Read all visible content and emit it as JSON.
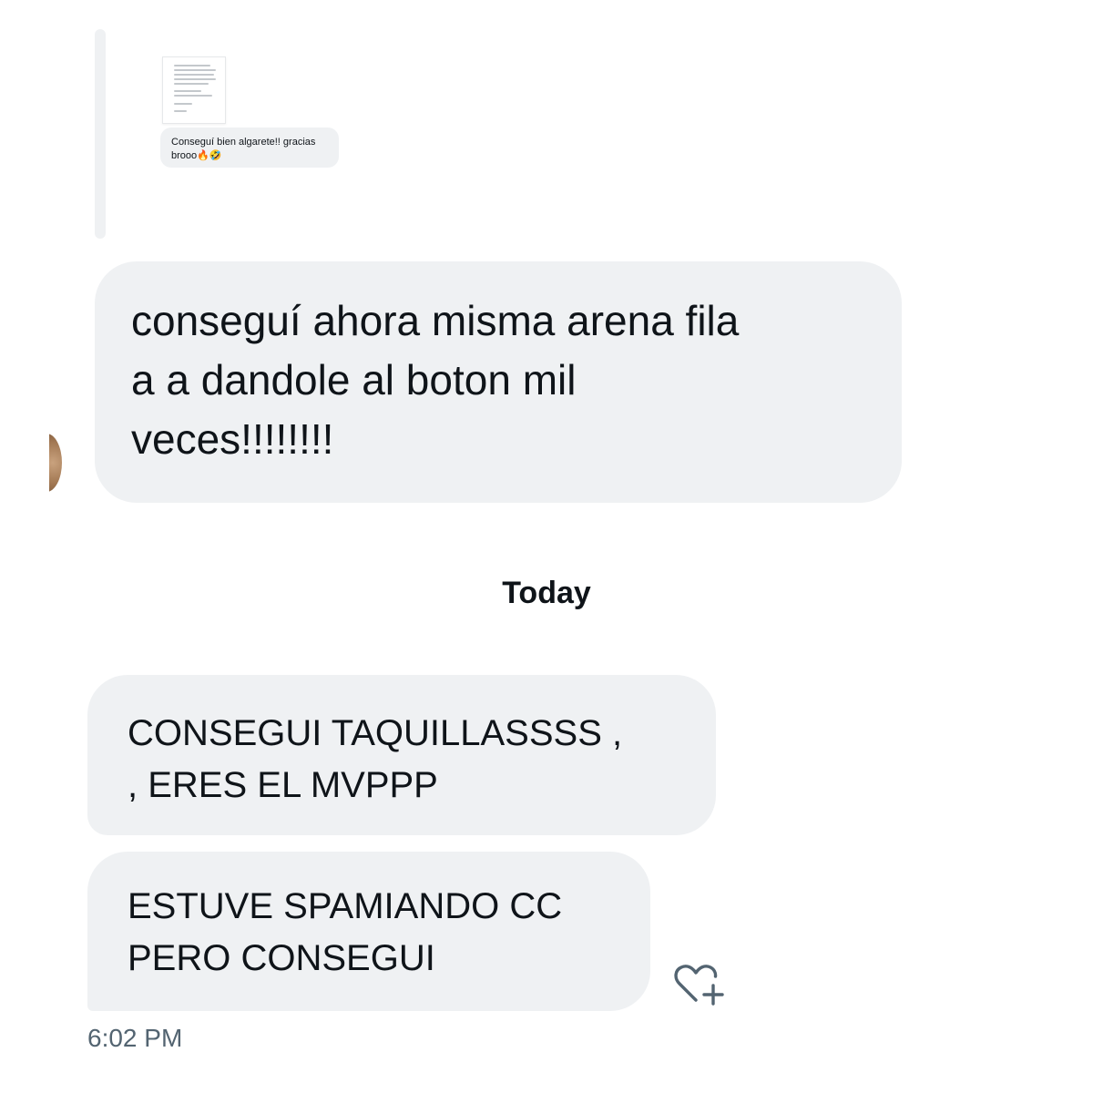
{
  "conversation": {
    "quoted_reply": {
      "attachment_icon": "document-thumbnail",
      "text": "Conseguí bien algarete!! gracias brooo🔥🤣"
    },
    "messages": [
      {
        "text": "conseguí ahora misma arena fila\na a dandole al boton mil\nveces!!!!!!!!"
      }
    ],
    "date_divider": "Today",
    "today_messages": [
      {
        "text": "CONSEGUI TAQUILLASSSS ,\n, ERES EL MVPPP"
      },
      {
        "text": "ESTUVE SPAMIANDO CC\nPERO CONSEGUI"
      }
    ],
    "react_icon": "heart-plus-icon",
    "timestamp": "6:02 PM"
  },
  "colors": {
    "bubble_bg": "#eff1f3",
    "text": "#0f1419",
    "muted": "#536471",
    "rail": "#eff1f3"
  }
}
